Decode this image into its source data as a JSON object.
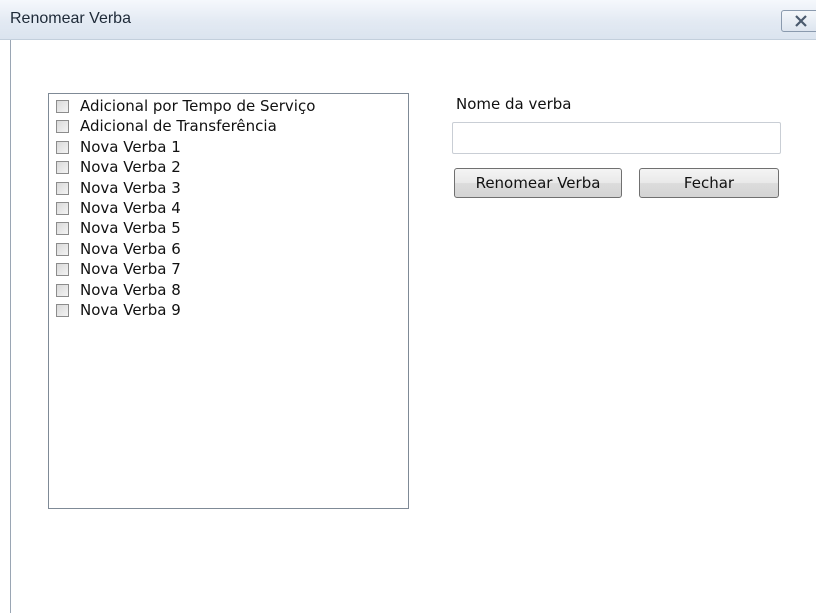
{
  "window": {
    "title": "Renomear Verba"
  },
  "list": {
    "items": [
      {
        "label": "Adicional por Tempo de Serviço",
        "checked": false
      },
      {
        "label": "Adicional de Transferência",
        "checked": false
      },
      {
        "label": "Nova Verba 1",
        "checked": false
      },
      {
        "label": "Nova Verba 2",
        "checked": false
      },
      {
        "label": "Nova Verba 3",
        "checked": false
      },
      {
        "label": "Nova Verba 4",
        "checked": false
      },
      {
        "label": "Nova Verba 5",
        "checked": false
      },
      {
        "label": "Nova Verba 6",
        "checked": false
      },
      {
        "label": "Nova Verba 7",
        "checked": false
      },
      {
        "label": "Nova Verba 8",
        "checked": false
      },
      {
        "label": "Nova Verba 9",
        "checked": false
      }
    ]
  },
  "form": {
    "field_label": "Nome da verba",
    "field_value": "",
    "rename_button": "Renomear Verba",
    "close_button": "Fechar"
  },
  "icons": {
    "close": "close-icon"
  }
}
